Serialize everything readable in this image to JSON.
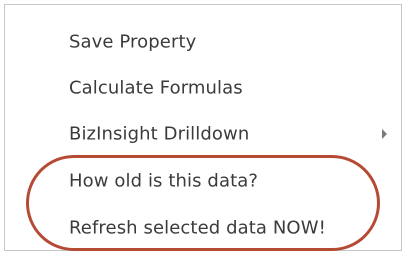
{
  "menu": {
    "items": [
      {
        "label": "Save Property",
        "has_submenu": false
      },
      {
        "label": "Calculate Formulas",
        "has_submenu": false
      },
      {
        "label": "BizInsight Drilldown",
        "has_submenu": true
      },
      {
        "label": "How old is this data?",
        "has_submenu": false
      },
      {
        "label": "Refresh selected data NOW!",
        "has_submenu": false
      }
    ],
    "submenu_icon": "chevron-right-icon"
  },
  "highlight": {
    "color": "#b54a35"
  }
}
